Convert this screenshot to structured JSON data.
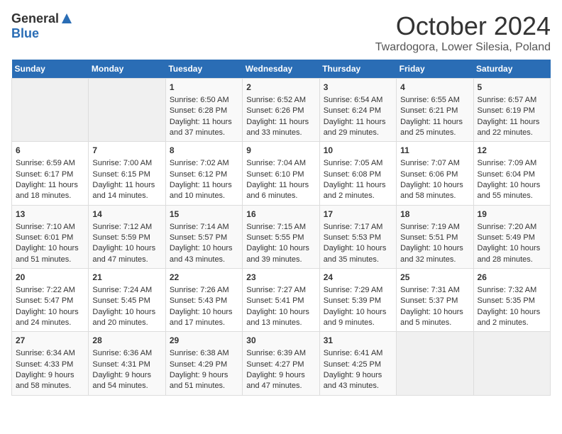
{
  "logo": {
    "line1": "General",
    "line2": "Blue"
  },
  "title": "October 2024",
  "location": "Twardogora, Lower Silesia, Poland",
  "days_of_week": [
    "Sunday",
    "Monday",
    "Tuesday",
    "Wednesday",
    "Thursday",
    "Friday",
    "Saturday"
  ],
  "weeks": [
    [
      {
        "day": "",
        "info": ""
      },
      {
        "day": "",
        "info": ""
      },
      {
        "day": "1",
        "info": "Sunrise: 6:50 AM\nSunset: 6:28 PM\nDaylight: 11 hours and 37 minutes."
      },
      {
        "day": "2",
        "info": "Sunrise: 6:52 AM\nSunset: 6:26 PM\nDaylight: 11 hours and 33 minutes."
      },
      {
        "day": "3",
        "info": "Sunrise: 6:54 AM\nSunset: 6:24 PM\nDaylight: 11 hours and 29 minutes."
      },
      {
        "day": "4",
        "info": "Sunrise: 6:55 AM\nSunset: 6:21 PM\nDaylight: 11 hours and 25 minutes."
      },
      {
        "day": "5",
        "info": "Sunrise: 6:57 AM\nSunset: 6:19 PM\nDaylight: 11 hours and 22 minutes."
      }
    ],
    [
      {
        "day": "6",
        "info": "Sunrise: 6:59 AM\nSunset: 6:17 PM\nDaylight: 11 hours and 18 minutes."
      },
      {
        "day": "7",
        "info": "Sunrise: 7:00 AM\nSunset: 6:15 PM\nDaylight: 11 hours and 14 minutes."
      },
      {
        "day": "8",
        "info": "Sunrise: 7:02 AM\nSunset: 6:12 PM\nDaylight: 11 hours and 10 minutes."
      },
      {
        "day": "9",
        "info": "Sunrise: 7:04 AM\nSunset: 6:10 PM\nDaylight: 11 hours and 6 minutes."
      },
      {
        "day": "10",
        "info": "Sunrise: 7:05 AM\nSunset: 6:08 PM\nDaylight: 11 hours and 2 minutes."
      },
      {
        "day": "11",
        "info": "Sunrise: 7:07 AM\nSunset: 6:06 PM\nDaylight: 10 hours and 58 minutes."
      },
      {
        "day": "12",
        "info": "Sunrise: 7:09 AM\nSunset: 6:04 PM\nDaylight: 10 hours and 55 minutes."
      }
    ],
    [
      {
        "day": "13",
        "info": "Sunrise: 7:10 AM\nSunset: 6:01 PM\nDaylight: 10 hours and 51 minutes."
      },
      {
        "day": "14",
        "info": "Sunrise: 7:12 AM\nSunset: 5:59 PM\nDaylight: 10 hours and 47 minutes."
      },
      {
        "day": "15",
        "info": "Sunrise: 7:14 AM\nSunset: 5:57 PM\nDaylight: 10 hours and 43 minutes."
      },
      {
        "day": "16",
        "info": "Sunrise: 7:15 AM\nSunset: 5:55 PM\nDaylight: 10 hours and 39 minutes."
      },
      {
        "day": "17",
        "info": "Sunrise: 7:17 AM\nSunset: 5:53 PM\nDaylight: 10 hours and 35 minutes."
      },
      {
        "day": "18",
        "info": "Sunrise: 7:19 AM\nSunset: 5:51 PM\nDaylight: 10 hours and 32 minutes."
      },
      {
        "day": "19",
        "info": "Sunrise: 7:20 AM\nSunset: 5:49 PM\nDaylight: 10 hours and 28 minutes."
      }
    ],
    [
      {
        "day": "20",
        "info": "Sunrise: 7:22 AM\nSunset: 5:47 PM\nDaylight: 10 hours and 24 minutes."
      },
      {
        "day": "21",
        "info": "Sunrise: 7:24 AM\nSunset: 5:45 PM\nDaylight: 10 hours and 20 minutes."
      },
      {
        "day": "22",
        "info": "Sunrise: 7:26 AM\nSunset: 5:43 PM\nDaylight: 10 hours and 17 minutes."
      },
      {
        "day": "23",
        "info": "Sunrise: 7:27 AM\nSunset: 5:41 PM\nDaylight: 10 hours and 13 minutes."
      },
      {
        "day": "24",
        "info": "Sunrise: 7:29 AM\nSunset: 5:39 PM\nDaylight: 10 hours and 9 minutes."
      },
      {
        "day": "25",
        "info": "Sunrise: 7:31 AM\nSunset: 5:37 PM\nDaylight: 10 hours and 5 minutes."
      },
      {
        "day": "26",
        "info": "Sunrise: 7:32 AM\nSunset: 5:35 PM\nDaylight: 10 hours and 2 minutes."
      }
    ],
    [
      {
        "day": "27",
        "info": "Sunrise: 6:34 AM\nSunset: 4:33 PM\nDaylight: 9 hours and 58 minutes."
      },
      {
        "day": "28",
        "info": "Sunrise: 6:36 AM\nSunset: 4:31 PM\nDaylight: 9 hours and 54 minutes."
      },
      {
        "day": "29",
        "info": "Sunrise: 6:38 AM\nSunset: 4:29 PM\nDaylight: 9 hours and 51 minutes."
      },
      {
        "day": "30",
        "info": "Sunrise: 6:39 AM\nSunset: 4:27 PM\nDaylight: 9 hours and 47 minutes."
      },
      {
        "day": "31",
        "info": "Sunrise: 6:41 AM\nSunset: 4:25 PM\nDaylight: 9 hours and 43 minutes."
      },
      {
        "day": "",
        "info": ""
      },
      {
        "day": "",
        "info": ""
      }
    ]
  ]
}
